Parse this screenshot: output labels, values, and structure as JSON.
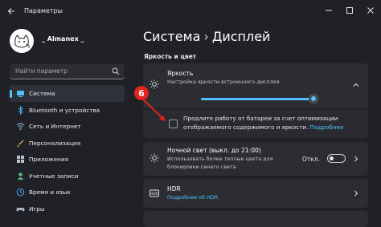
{
  "window": {
    "app_title": "Параметры"
  },
  "profile": {
    "username": "_ Almanex _"
  },
  "search": {
    "placeholder": "Найти параметр"
  },
  "sidebar": {
    "items": [
      {
        "label": "Система",
        "icon": "system-icon",
        "active": true
      },
      {
        "label": "Bluetooth и устройства",
        "icon": "bluetooth-icon"
      },
      {
        "label": "Сеть и Интернет",
        "icon": "network-icon"
      },
      {
        "label": "Персонализация",
        "icon": "personalization-icon"
      },
      {
        "label": "Приложения",
        "icon": "apps-icon"
      },
      {
        "label": "Учетные записи",
        "icon": "accounts-icon"
      },
      {
        "label": "Время и язык",
        "icon": "time-language-icon"
      },
      {
        "label": "Игры",
        "icon": "gaming-icon"
      }
    ]
  },
  "breadcrumb": {
    "parent": "Система",
    "separator": "›",
    "current": "Дисплей"
  },
  "section": {
    "title": "Яркость и цвет"
  },
  "brightness": {
    "title": "Яркость",
    "subtitle": "Настройка яркости встроенного дисплея",
    "level_percent": 100
  },
  "battery": {
    "text": "Продлите работу от батареи за счет оптимизации отображаемого содержимого и яркости.",
    "link": "Подробнее",
    "checked": false
  },
  "night_light": {
    "title": "Ночной свет (выкл. до 21:00)",
    "subtitle_line1": "Использовать более теплые цвета для",
    "subtitle_line2": "блокировки синего света",
    "toggle_label": "Откл.",
    "on": false
  },
  "hdr": {
    "title": "HDR",
    "link": "Подробнее об HDR"
  },
  "annotation": {
    "number": "6"
  },
  "colors": {
    "accent": "#4cc2ff",
    "callout": "#e0241b",
    "background": "#1f2126",
    "card": "#2b2d33"
  }
}
